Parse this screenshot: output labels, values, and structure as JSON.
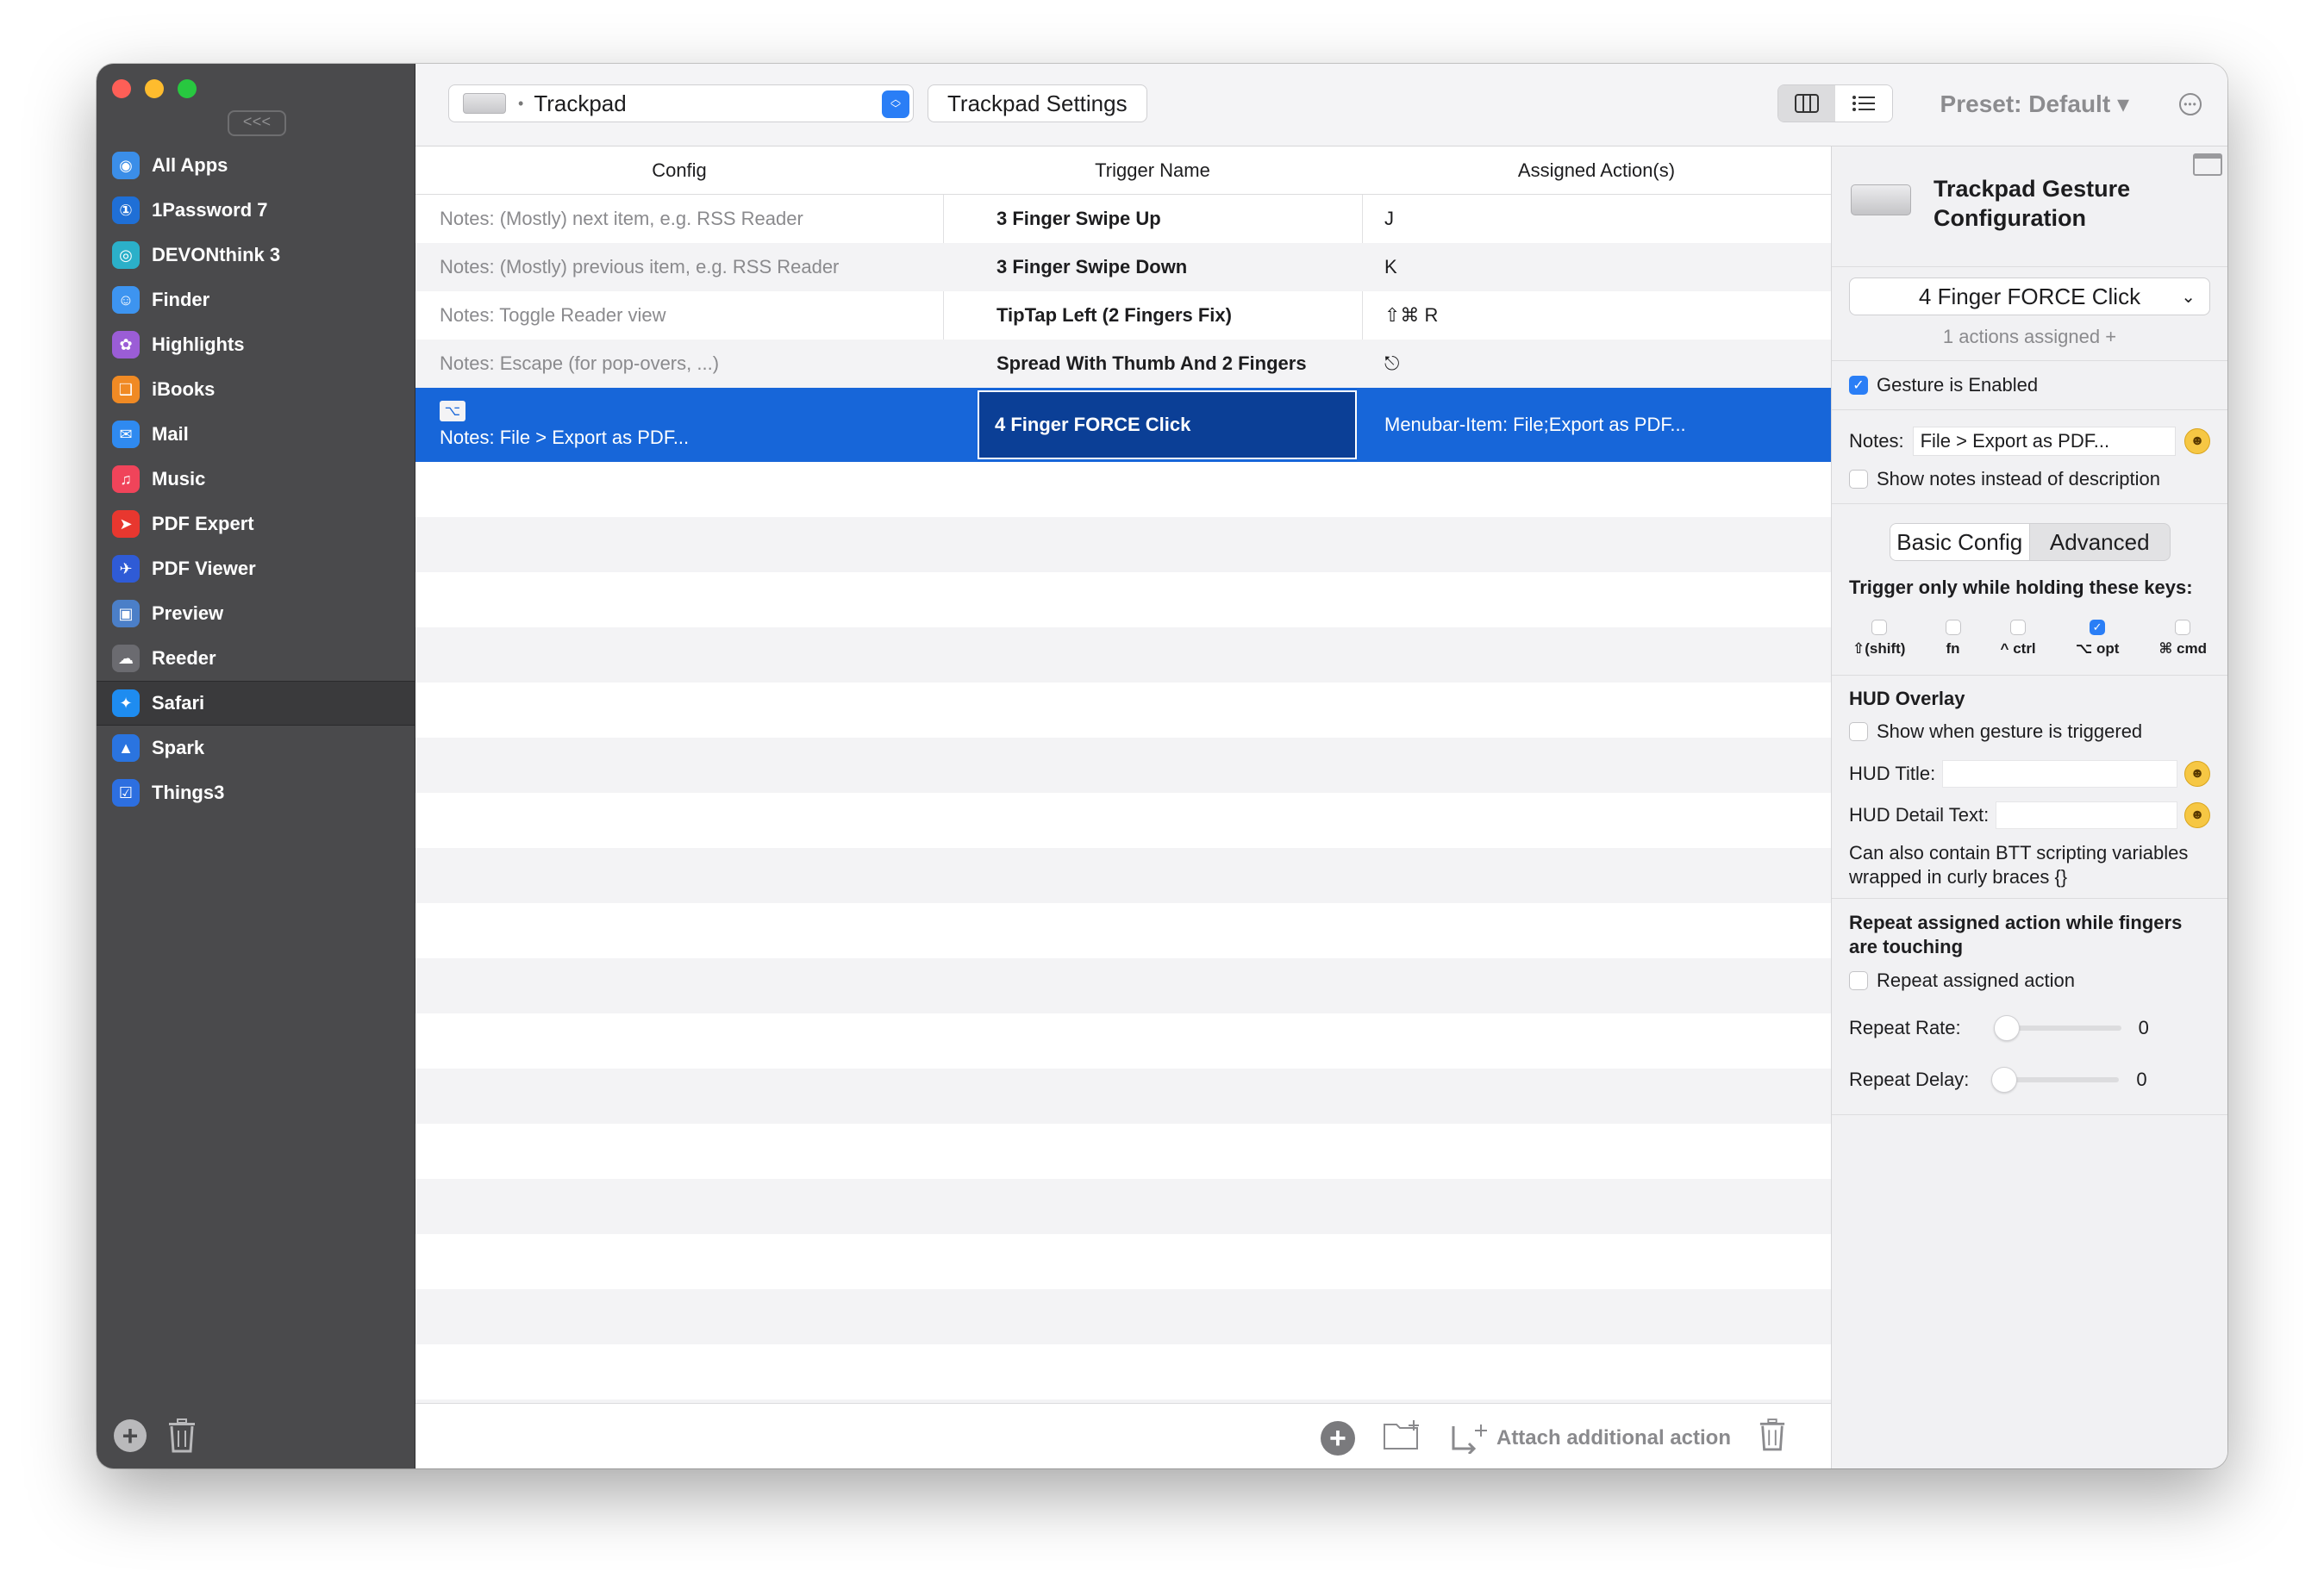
{
  "sidebar": {
    "collapse_label": "<<<",
    "apps": [
      {
        "label": "All Apps",
        "icon": "globe-icon",
        "color": "#3b8ee8",
        "glyph": "◉"
      },
      {
        "label": "1Password 7",
        "icon": "1password-icon",
        "color": "#1f6fd6",
        "glyph": "①"
      },
      {
        "label": "DEVONthink 3",
        "icon": "devonthink-icon",
        "color": "#2bb0c9",
        "glyph": "◎"
      },
      {
        "label": "Finder",
        "icon": "finder-icon",
        "color": "#3d94f0",
        "glyph": "☺"
      },
      {
        "label": "Highlights",
        "icon": "highlights-icon",
        "color": "#9b5dd6",
        "glyph": "✿"
      },
      {
        "label": "iBooks",
        "icon": "books-icon",
        "color": "#f08a24",
        "glyph": "❑"
      },
      {
        "label": "Mail",
        "icon": "mail-icon",
        "color": "#2f8af0",
        "glyph": "✉"
      },
      {
        "label": "Music",
        "icon": "music-icon",
        "color": "#f0445a",
        "glyph": "♫"
      },
      {
        "label": "PDF Expert",
        "icon": "pdf-expert-icon",
        "color": "#e8372f",
        "glyph": "➤"
      },
      {
        "label": "PDF Viewer",
        "icon": "pdf-viewer-icon",
        "color": "#2f5bd6",
        "glyph": "✈"
      },
      {
        "label": "Preview",
        "icon": "preview-icon",
        "color": "#4b7fc8",
        "glyph": "▣"
      },
      {
        "label": "Reeder",
        "icon": "reeder-icon",
        "color": "#6b6b70",
        "glyph": "☁"
      },
      {
        "label": "Safari",
        "icon": "safari-icon",
        "color": "#1e8cf0",
        "glyph": "✦",
        "selected": true
      },
      {
        "label": "Spark",
        "icon": "spark-icon",
        "color": "#2a74e0",
        "glyph": "▲"
      },
      {
        "label": "Things3",
        "icon": "things-icon",
        "color": "#2d6fe0",
        "glyph": "☑"
      }
    ]
  },
  "toolbar": {
    "device": "Trackpad",
    "settings_label": "Trackpad Settings",
    "preset_label": "Preset: Default ▾"
  },
  "table": {
    "headers": [
      "Config",
      "Trigger Name",
      "Assigned Action(s)"
    ],
    "rows": [
      {
        "config": "Notes: (Mostly) next item, e.g. RSS Reader",
        "trigger": "3 Finger Swipe Up",
        "action": "J"
      },
      {
        "config": "Notes: (Mostly) previous item, e.g. RSS Reader",
        "trigger": "3 Finger Swipe Down",
        "action": "K"
      },
      {
        "config": "Notes: Toggle Reader view",
        "trigger": "TipTap Left (2 Fingers Fix)",
        "action": "⇧⌘ R"
      },
      {
        "config": "Notes: Escape (for pop-overs, ...)",
        "trigger": "Spread With Thumb And 2 Fingers",
        "action": "⎋"
      }
    ],
    "selected_row": {
      "badge": "⌥",
      "config": "Notes: File > Export as PDF...",
      "trigger": "4 Finger FORCE Click",
      "action": "Menubar-Item: File;Export as PDF..."
    }
  },
  "footer": {
    "attach_label": "Attach additional action"
  },
  "panel": {
    "title": "Trackpad Gesture Configuration",
    "trigger_select": "4 Finger FORCE Click",
    "assigned_text": "1 actions assigned +",
    "gesture_enabled_label": "Gesture is Enabled",
    "notes_label": "Notes:",
    "notes_value": "File > Export as PDF...",
    "show_notes_label": "Show notes instead of description",
    "tabs": [
      "Basic Config",
      "Advanced"
    ],
    "modkeys_title": "Trigger only while holding these keys:",
    "modkeys": [
      {
        "label": "⇧(shift)",
        "checked": false
      },
      {
        "label": "fn",
        "checked": false
      },
      {
        "label": "^ ctrl",
        "checked": false
      },
      {
        "label": "⌥ opt",
        "checked": true
      },
      {
        "label": "⌘ cmd",
        "checked": false
      }
    ],
    "hud_title": "HUD Overlay",
    "hud_show_label": "Show when gesture is triggered",
    "hud_title_label": "HUD Title:",
    "hud_detail_label": "HUD Detail Text:",
    "hud_note": "Can also contain BTT scripting variables wrapped in curly braces {}",
    "repeat_title": "Repeat assigned action while fingers are touching",
    "repeat_label": "Repeat assigned action",
    "repeat_rate_label": "Repeat Rate:",
    "repeat_rate_value": "0",
    "repeat_delay_label": "Repeat Delay:",
    "repeat_delay_value": "0"
  },
  "colors": {
    "accent": "#1766d9",
    "sidebar": "#4a4a4c"
  }
}
